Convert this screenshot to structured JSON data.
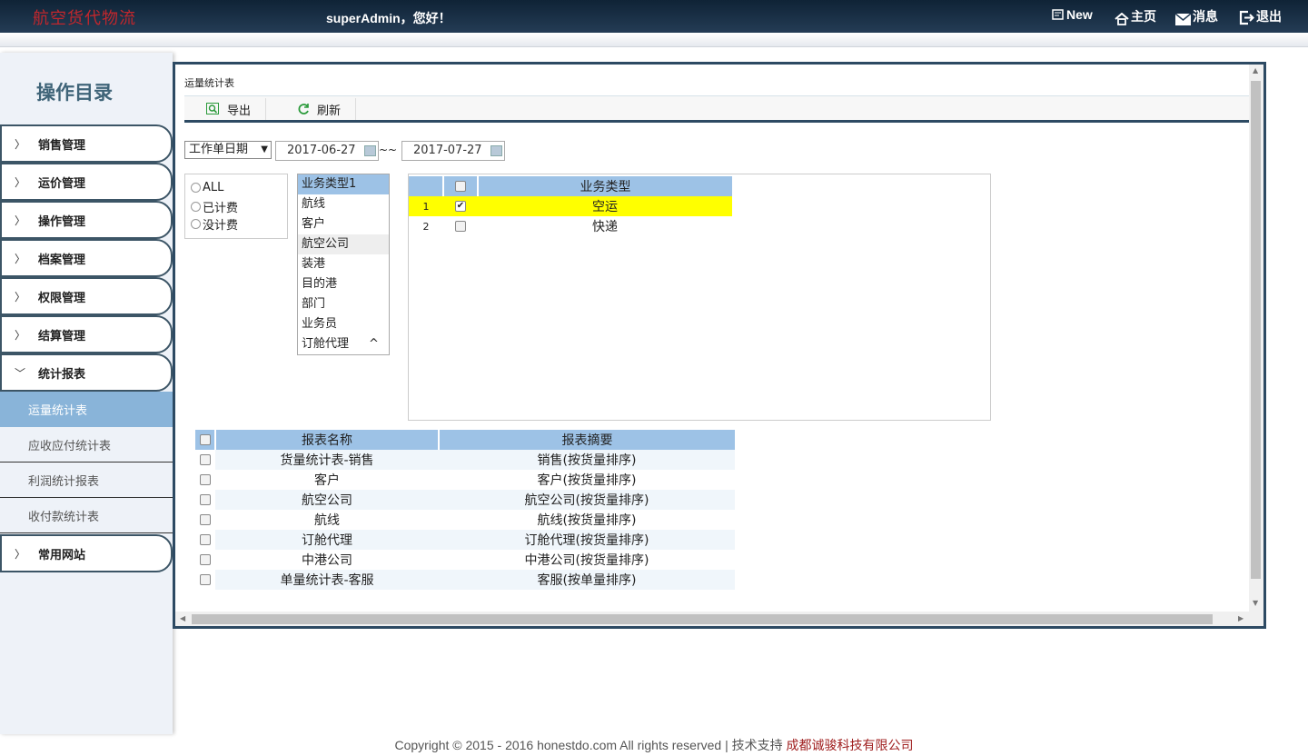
{
  "header": {
    "logo": "航空货代物流",
    "greeting": "superAdmin，您好！",
    "nav": [
      {
        "label": "New",
        "icon": "new-doc-icon"
      },
      {
        "label": "主页",
        "icon": "home-icon"
      },
      {
        "label": "消息",
        "icon": "mail-icon"
      },
      {
        "label": "退出",
        "icon": "logout-icon"
      }
    ]
  },
  "sidebar": {
    "title": "操作目录",
    "menu": [
      {
        "label": "销售管理",
        "expanded": false
      },
      {
        "label": "运价管理",
        "expanded": false
      },
      {
        "label": "操作管理",
        "expanded": false
      },
      {
        "label": "档案管理",
        "expanded": false
      },
      {
        "label": "权限管理",
        "expanded": false
      },
      {
        "label": "结算管理",
        "expanded": false
      },
      {
        "label": "统计报表",
        "expanded": true
      },
      {
        "label": "常用网站",
        "expanded": false
      }
    ],
    "submenu": [
      "运量统计表",
      "应收应付统计表",
      "利润统计报表",
      "收付款统计表"
    ],
    "active_submenu": "运量统计表"
  },
  "main": {
    "breadcrumb": "运量统计表",
    "toolbar": {
      "export_label": "导出",
      "refresh_label": "刷新"
    },
    "filter": {
      "date_field": "工作单日期",
      "date_from": "2017-06-27",
      "date_sep": "~~",
      "date_to": "2017-07-27"
    },
    "fee_options": [
      "ALL",
      "已计费",
      "没计费"
    ],
    "dimension_list": [
      "业务类型1",
      "航线",
      "客户",
      "航空公司",
      "装港",
      "目的港",
      "部门",
      "业务员",
      "订舱代理"
    ],
    "dimension_scroll_hint": "^",
    "type_grid": {
      "header": "业务类型",
      "rows": [
        {
          "no": "1",
          "name": "空运",
          "checked": true
        },
        {
          "no": "2",
          "name": "快递",
          "checked": false
        }
      ]
    },
    "report_grid": {
      "headers": [
        "报表名称",
        "报表摘要"
      ],
      "rows": [
        [
          "货量统计表-销售",
          "销售(按货量排序)"
        ],
        [
          "客户",
          "客户(按货量排序)"
        ],
        [
          "航空公司",
          "航空公司(按货量排序)"
        ],
        [
          "航线",
          "航线(按货量排序)"
        ],
        [
          "订舱代理",
          "订舱代理(按货量排序)"
        ],
        [
          "中港公司",
          "中港公司(按货量排序)"
        ],
        [
          "单量统计表-客服",
          "客服(按单量排序)"
        ]
      ]
    }
  },
  "footer": {
    "text": "Copyright © 2015 - 2016 honestdo.com All rights reserved | 技术支持 ",
    "company": "成都诚骏科技有限公司"
  }
}
